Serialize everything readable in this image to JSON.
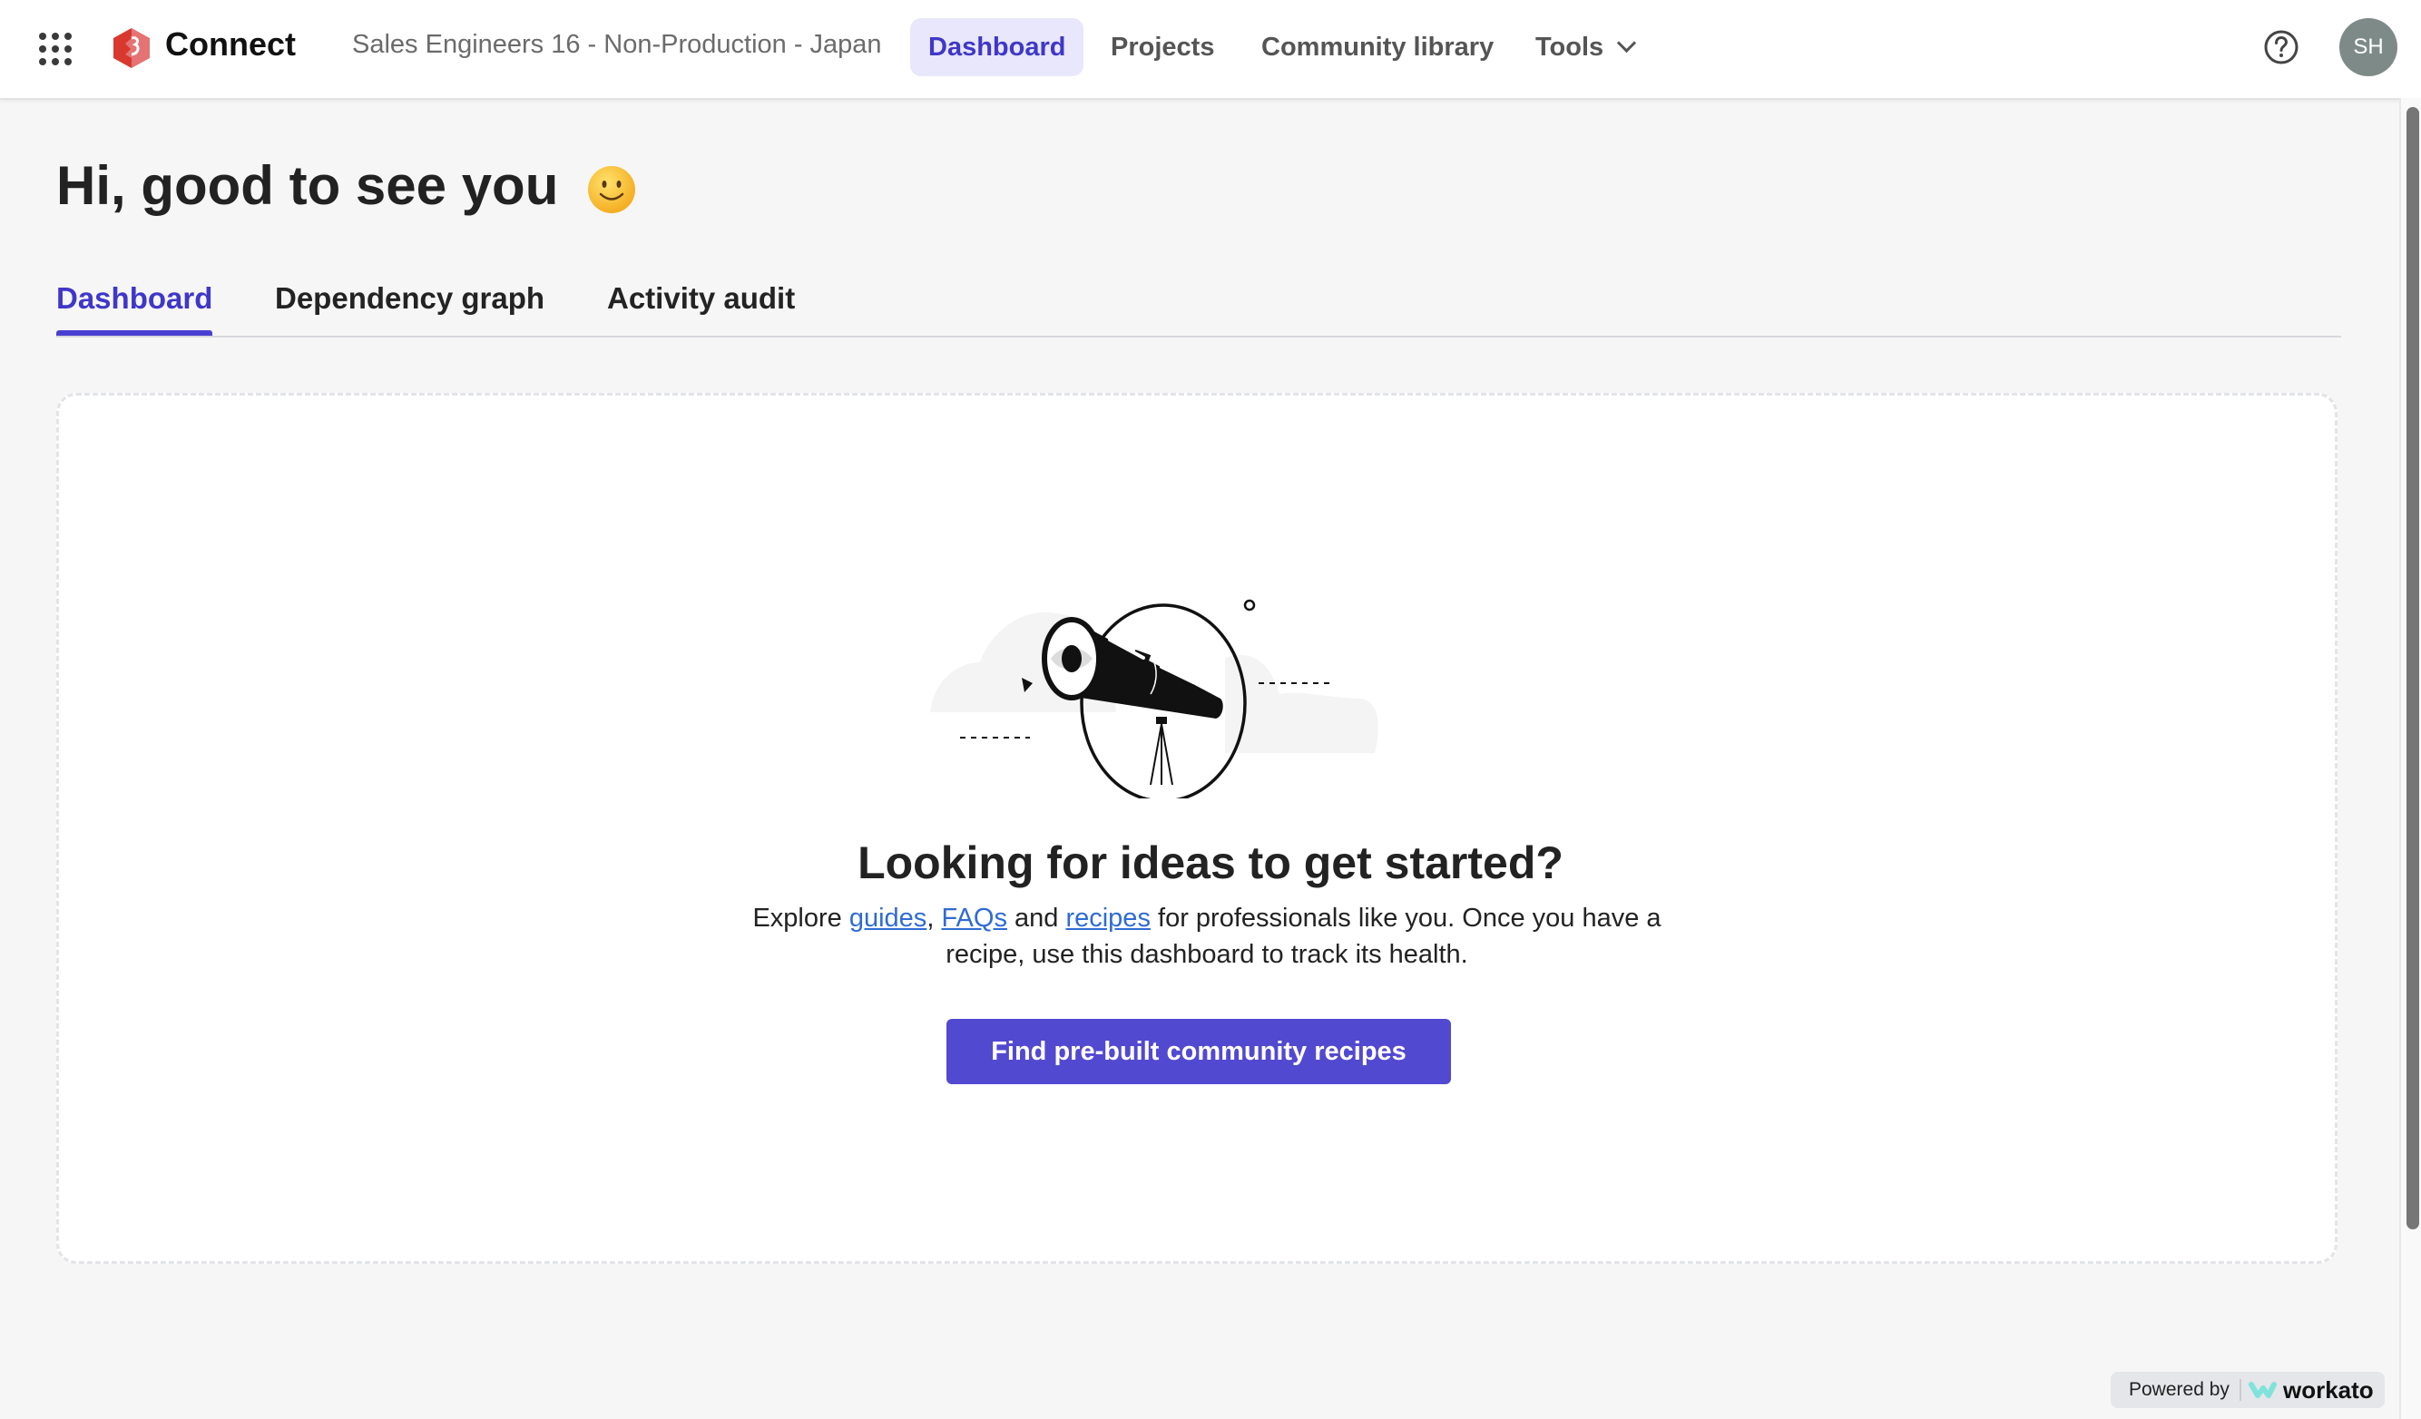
{
  "topbar": {
    "apps_icon": "grid-dots-icon",
    "brand": "Connect",
    "workspace": "Sales Engineers 16 - Non-Production - Japan",
    "nav": [
      {
        "label": "Dashboard",
        "active": true
      },
      {
        "label": "Projects",
        "active": false
      },
      {
        "label": "Community library",
        "active": false
      },
      {
        "label": "Tools",
        "active": false,
        "has_dropdown": true
      }
    ],
    "help_icon": "question-circle-icon",
    "avatar_initials": "SH"
  },
  "greeting": {
    "text": "Hi, good to see you",
    "emoji": "slightly-smiling-face"
  },
  "tabs": [
    {
      "label": "Dashboard",
      "active": true
    },
    {
      "label": "Dependency graph",
      "active": false
    },
    {
      "label": "Activity audit",
      "active": false
    }
  ],
  "empty_state": {
    "illustration": "telescope-illustration",
    "headline": "Looking for ideas to get started?",
    "body_prefix": "Explore ",
    "link_guides": "guides",
    "sep_comma": ", ",
    "link_faqs": "FAQs",
    "sep_and": " and ",
    "link_recipes": "recipes",
    "body_suffix": " for professionals like you. Once you have a recipe, use this dashboard to track its health.",
    "cta_label": "Find pre-built community recipes"
  },
  "footer": {
    "powered_by": "Powered by",
    "vendor": "workato"
  },
  "colors": {
    "accent": "#5249d1",
    "active_nav_bg": "#e8e7fb",
    "link": "#2f6bd3",
    "avatar_bg": "#7d8a88",
    "brand_logo": "#d9382f",
    "workato_logo": "#7fe3dc"
  }
}
